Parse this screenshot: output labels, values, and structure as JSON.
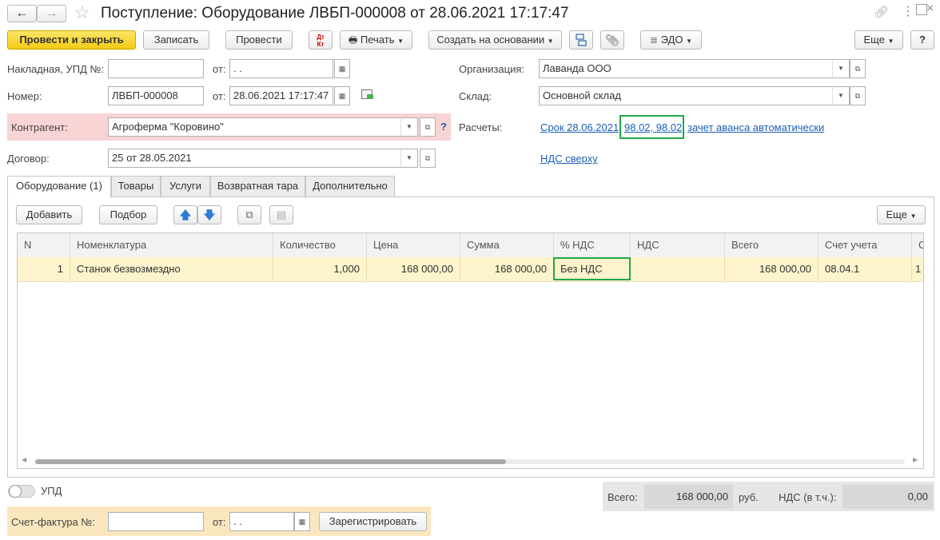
{
  "window": {
    "title": "Поступление: Оборудование ЛВБП-000008 от 28.06.2021 17:17:47"
  },
  "toolbar": {
    "post_close": "Провести и закрыть",
    "save": "Записать",
    "post": "Провести",
    "dt_kt": "Дт Кт",
    "print": "Печать",
    "create_based": "Создать на основании",
    "edo": "ЭДО",
    "more": "Еще",
    "help": "?"
  },
  "form": {
    "invoice_label": "Накладная, УПД №:",
    "invoice_value": "",
    "from_label": "от:",
    "invoice_date": " .  .",
    "number_label": "Номер:",
    "number_value": "ЛВБП-000008",
    "number_date": "28.06.2021 17:17:47",
    "contractor_label": "Контрагент:",
    "contractor_value": "Агроферма \"Коровино\"",
    "contract_label": "Договор:",
    "contract_value": "25 от 28.05.2021",
    "org_label": "Организация:",
    "org_value": "Лаванда ООО",
    "warehouse_label": "Склад:",
    "warehouse_value": "Основной склад",
    "payments_label": "Расчеты:",
    "payments_link_a": "Срок 28.06.2021,",
    "payments_link_b": "98.02, 98.02,",
    "payments_link_c": "зачет аванса автоматически",
    "vat_link": "НДС сверху",
    "help_q": "?"
  },
  "tabs": [
    {
      "label": "Оборудование (1)",
      "active": true
    },
    {
      "label": "Товары",
      "active": false
    },
    {
      "label": "Услуги",
      "active": false
    },
    {
      "label": "Возвратная тара",
      "active": false
    },
    {
      "label": "Дополнительно",
      "active": false
    }
  ],
  "table_toolbar": {
    "add": "Добавить",
    "select": "Подбор",
    "more": "Еще"
  },
  "table": {
    "columns": [
      "N",
      "Номенклатура",
      "Количество",
      "Цена",
      "Сумма",
      "% НДС",
      "НДС",
      "Всего",
      "Счет учета",
      "С"
    ],
    "rows": [
      {
        "n": "1",
        "name": "Станок безвозмездно",
        "qty": "1,000",
        "price": "168 000,00",
        "sum": "168 000,00",
        "vat_rate": "Без НДС",
        "vat": "",
        "total": "168 000,00",
        "account": "08.04.1",
        "extra": "1"
      }
    ]
  },
  "footer": {
    "upd_label": "УПД",
    "total_label": "Всего:",
    "total_value": "168 000,00",
    "currency": "руб.",
    "vat_label": "НДС (в т.ч.):",
    "vat_value": "0,00",
    "sf_label": "Счет-фактура №:",
    "sf_value": "",
    "sf_from": "от:",
    "sf_date": " .  .",
    "register": "Зарегистрировать"
  },
  "colors": {
    "highlight_green": "#22a745",
    "yellow_button": "#f4cb14",
    "row_selected": "#fdf3cc",
    "contractor_bg": "#f8d4d4",
    "sf_bg": "#fbe7bf",
    "link": "#1a5fb4"
  }
}
